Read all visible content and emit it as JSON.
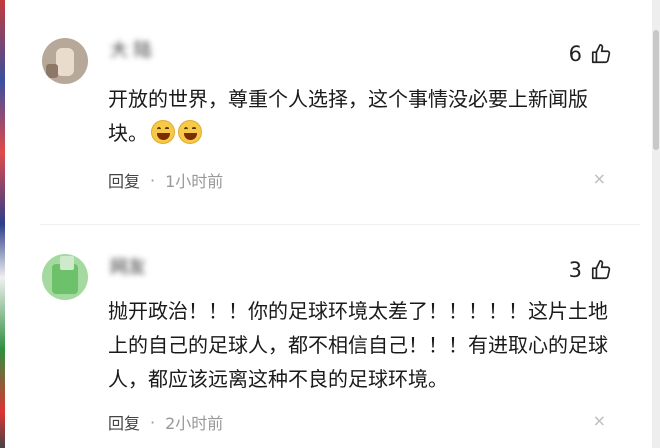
{
  "comments": [
    {
      "username": "大 陆",
      "likes": "6",
      "text": "开放的世界，尊重个人选择，这个事情没必要上新闻版块。",
      "emojis": [
        "grinning-face",
        "grinning-face"
      ],
      "reply_label": "回复",
      "separator": "·",
      "time": "1小时前",
      "close": "×"
    },
    {
      "username": "网友",
      "likes": "3",
      "text": "抛开政治！！！你的足球环境太差了！！！！！这片土地上的自己的足球人，都不相信自己！！！有进取心的足球人，都应该远离这种不良的足球环境。",
      "reply_label": "回复",
      "separator": "·",
      "time": "2小时前",
      "close": "×"
    }
  ],
  "colors": {
    "text": "#1a1a1a",
    "meta": "#999999",
    "emoji": "#f7c948"
  }
}
